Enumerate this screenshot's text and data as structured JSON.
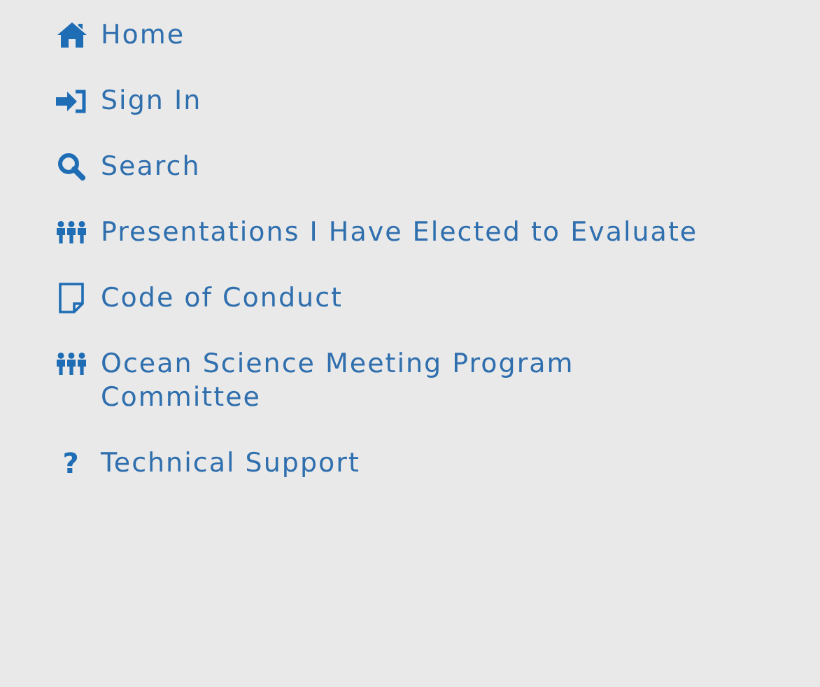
{
  "menu": {
    "items": [
      {
        "kind": "home",
        "lines": [
          "Home"
        ]
      },
      {
        "kind": "sign-in",
        "lines": [
          "Sign In"
        ]
      },
      {
        "kind": "search",
        "lines": [
          "Search"
        ]
      },
      {
        "kind": "people",
        "lines": [
          "Presentations I Have Elected to Evaluate"
        ]
      },
      {
        "kind": "document",
        "lines": [
          "Code of Conduct"
        ]
      },
      {
        "kind": "people",
        "lines": [
          "Ocean Science Meeting Program",
          "Committee"
        ]
      },
      {
        "kind": "help",
        "glyph": "?",
        "lines": [
          "Technical Support"
        ]
      }
    ]
  }
}
